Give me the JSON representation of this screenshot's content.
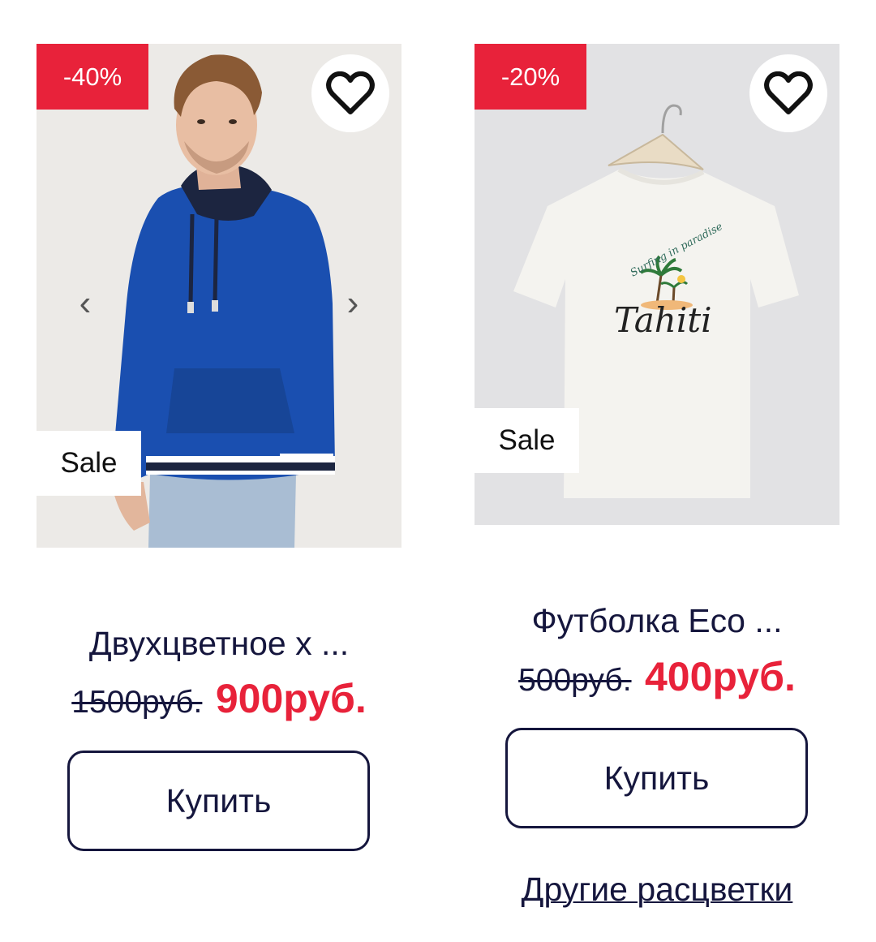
{
  "products": [
    {
      "discount": "-40%",
      "badge": "Sale",
      "title": "Двухцветное х ...",
      "old_price": "1500руб.",
      "new_price": "900руб.",
      "buy_label": "Купить",
      "prev_arrow": "‹",
      "next_arrow": "›",
      "favorite_icon": "heart-outline-icon",
      "image_desc_icon": "blue-hoodie-photo"
    },
    {
      "discount": "-20%",
      "badge": "Sale",
      "title": "Футболка Eco ...",
      "old_price": "500руб.",
      "new_price": "400руб.",
      "buy_label": "Купить",
      "other_colors": "Другие расцветки",
      "favorite_icon": "heart-outline-icon",
      "print_top": "Surfing in paradise",
      "print_main": "Tahiti"
    }
  ],
  "colors": {
    "accent_red": "#e8223a",
    "text_navy": "#15163d",
    "hoodie_blue": "#1a4fb0"
  }
}
